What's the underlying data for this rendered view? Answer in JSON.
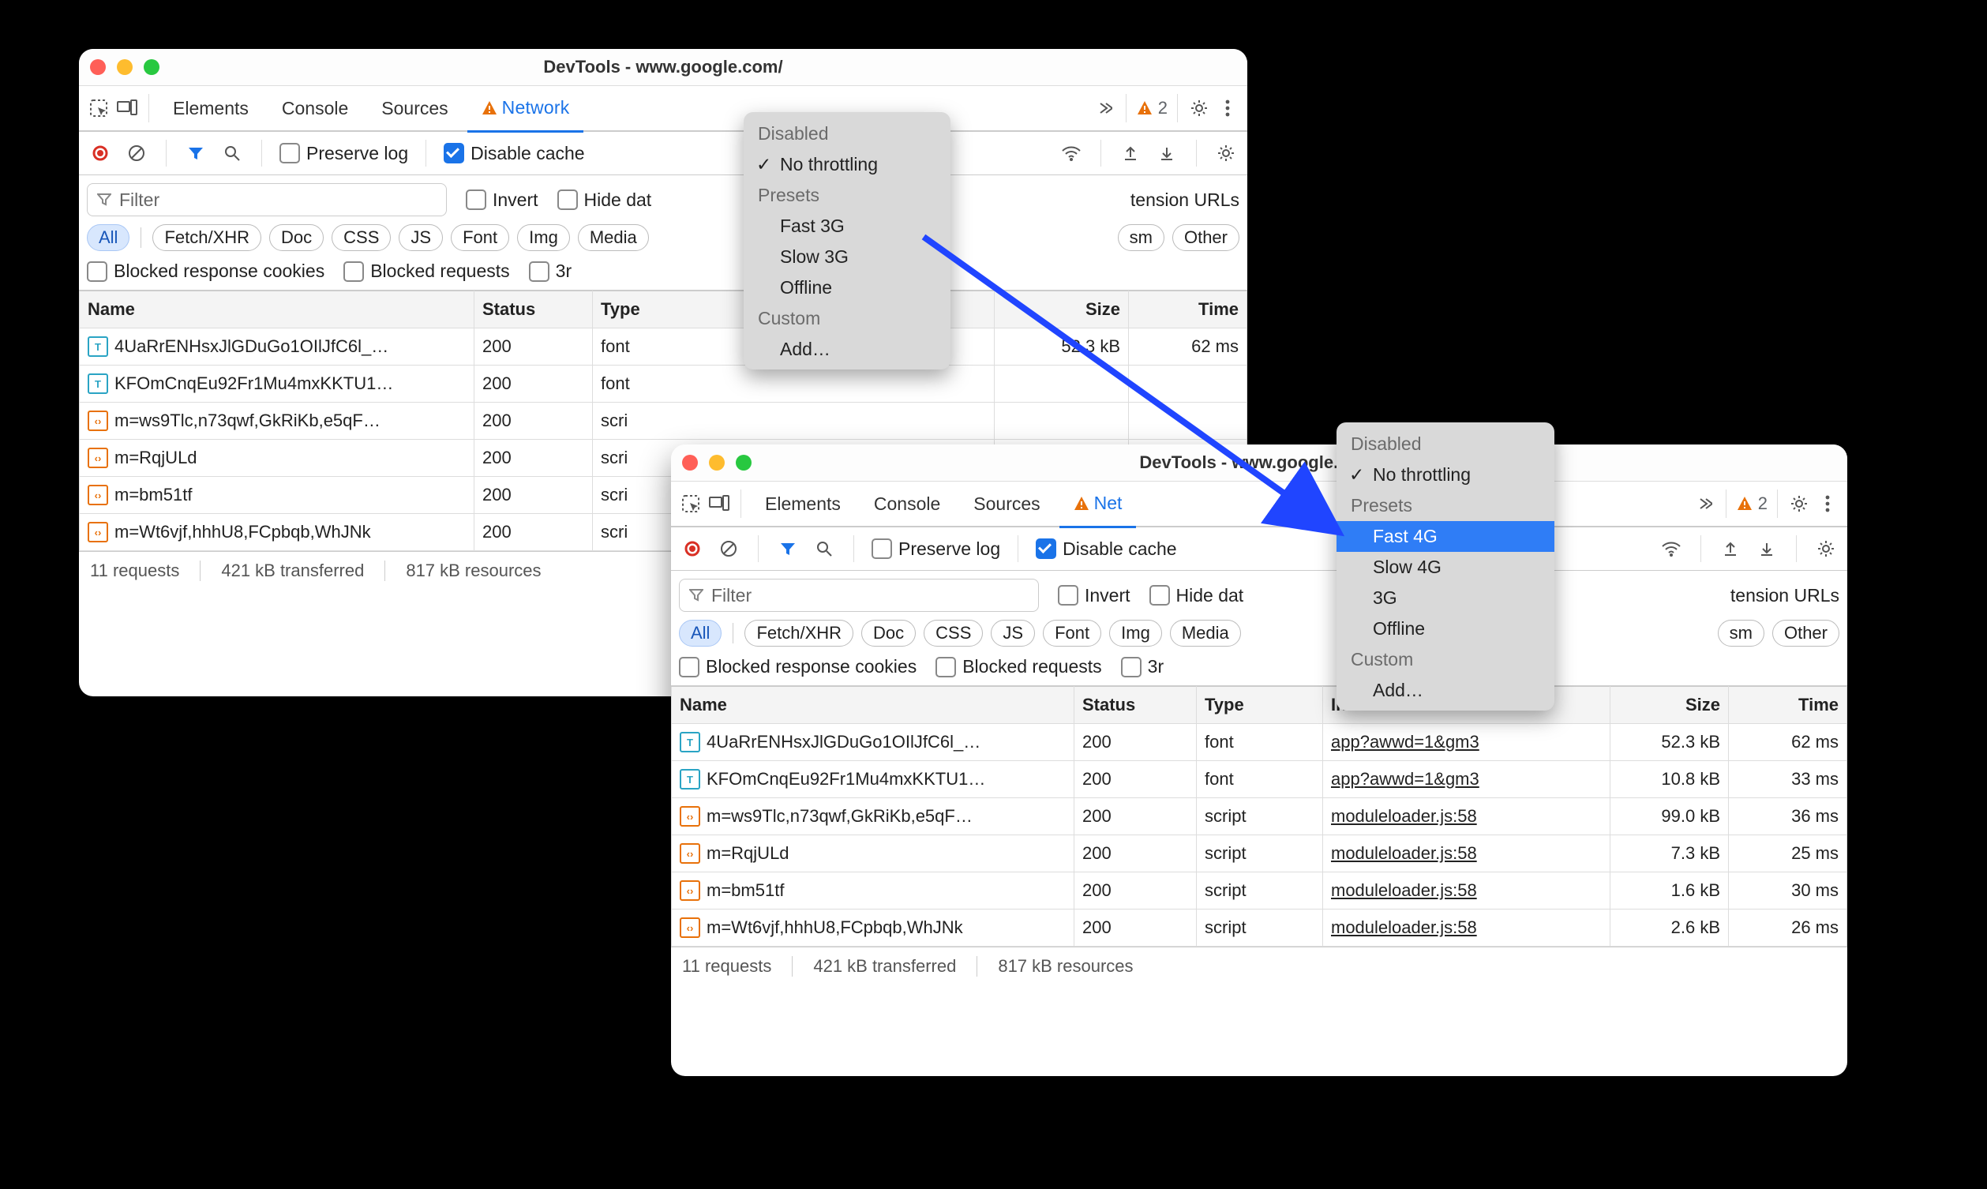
{
  "window_title": "DevTools - www.google.com/",
  "tabs": {
    "elements": "Elements",
    "console": "Console",
    "sources": "Sources",
    "network": "Network"
  },
  "warn_count": "2",
  "toolbar": {
    "preserve": "Preserve log",
    "disable_cache": "Disable cache"
  },
  "filter": {
    "placeholder": "Filter",
    "invert": "Invert",
    "hide_data": "Hide dat",
    "ext_urls_trunc": "tension URLs",
    "blocked_cookies": "Blocked response cookies",
    "blocked_requests": "Blocked requests",
    "third": "3r",
    "third2": "3r",
    "chips": {
      "all": "All",
      "fetch": "Fetch/XHR",
      "doc": "Doc",
      "css": "CSS",
      "js": "JS",
      "font": "Font",
      "img": "Img",
      "media": "Media",
      "sm": "sm",
      "other": "Other"
    }
  },
  "cols": {
    "name": "Name",
    "status": "Status",
    "type": "Type",
    "initiator": "Initiator",
    "size": "Size",
    "time": "Time"
  },
  "rows": [
    {
      "icon": "font",
      "name": "4UaRrENHsxJlGDuGo1OIlJfC6l_…",
      "status": "200",
      "type": "font",
      "initiator": "app?awwd=1&gm3",
      "size": "52.3 kB",
      "time": "62 ms"
    },
    {
      "icon": "font",
      "name": "KFOmCnqEu92Fr1Mu4mxKKTU1…",
      "status": "200",
      "type": "font",
      "initiator": "app?awwd=1&gm3",
      "size": "10.8 kB",
      "time": "33 ms"
    },
    {
      "icon": "script",
      "name": "m=ws9Tlc,n73qwf,GkRiKb,e5qF…",
      "status": "200",
      "type": "script",
      "initiator": "moduleloader.js:58",
      "size": "99.0 kB",
      "time": "36 ms"
    },
    {
      "icon": "script",
      "name": "m=RqjULd",
      "status": "200",
      "type": "script",
      "initiator": "moduleloader.js:58",
      "size": "7.3 kB",
      "time": "25 ms"
    },
    {
      "icon": "script",
      "name": "m=bm51tf",
      "status": "200",
      "type": "script",
      "initiator": "moduleloader.js:58",
      "size": "1.6 kB",
      "time": "30 ms"
    },
    {
      "icon": "script",
      "name": "m=Wt6vjf,hhhU8,FCpbqb,WhJNk",
      "status": "200",
      "type": "script",
      "initiator": "moduleloader.js:58",
      "size": "2.6 kB",
      "time": "26 ms"
    }
  ],
  "rows_left": [
    {
      "icon": "font",
      "name": "4UaRrENHsxJlGDuGo1OIlJfC6l_…",
      "status": "200",
      "type": "font",
      "size": "52.3 kB",
      "time": "62 ms"
    },
    {
      "icon": "font",
      "name": "KFOmCnqEu92Fr1Mu4mxKKTU1…",
      "status": "200",
      "type": "font",
      "size": "",
      "time": ""
    },
    {
      "icon": "script",
      "name": "m=ws9Tlc,n73qwf,GkRiKb,e5qF…",
      "status": "200",
      "type": "scri",
      "size": "",
      "time": ""
    },
    {
      "icon": "script",
      "name": "m=RqjULd",
      "status": "200",
      "type": "scri",
      "size": "",
      "time": ""
    },
    {
      "icon": "script",
      "name": "m=bm51tf",
      "status": "200",
      "type": "scri",
      "size": "",
      "time": ""
    },
    {
      "icon": "script",
      "name": "m=Wt6vjf,hhhU8,FCpbqb,WhJNk",
      "status": "200",
      "type": "scri",
      "size": "",
      "time": ""
    }
  ],
  "status": {
    "req": "11 requests",
    "transferred": "421 kB transferred",
    "resources": "817 kB resources"
  },
  "dd_left": {
    "disabled": "Disabled",
    "no_throttle": "No throttling",
    "presets": "Presets",
    "fast3g": "Fast 3G",
    "slow3g": "Slow 3G",
    "offline": "Offline",
    "custom": "Custom",
    "add": "Add…"
  },
  "dd_right": {
    "disabled": "Disabled",
    "no_throttle": "No throttling",
    "presets": "Presets",
    "fast4g": "Fast 4G",
    "slow4g": "Slow 4G",
    "g3": "3G",
    "offline": "Offline",
    "custom": "Custom",
    "add": "Add…"
  }
}
